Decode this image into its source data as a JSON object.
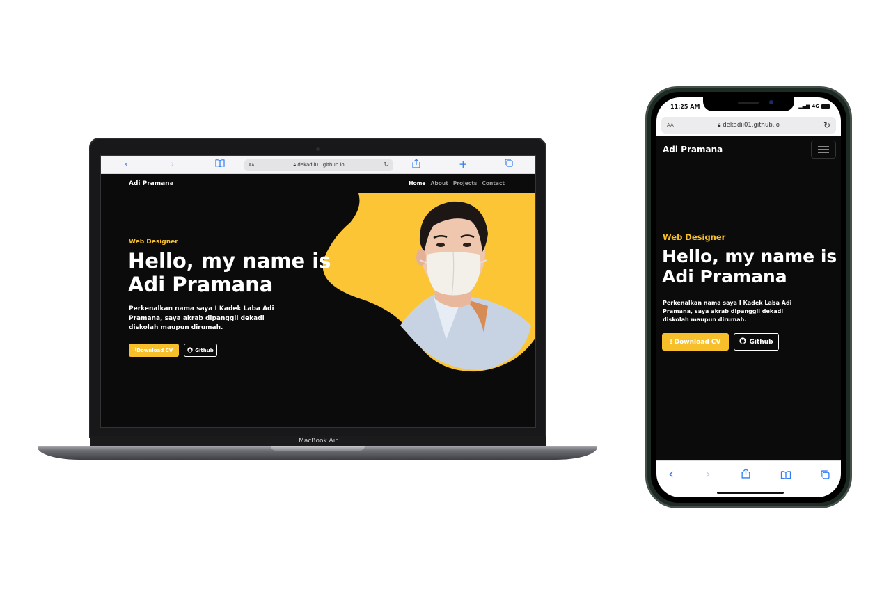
{
  "laptop": {
    "model_label": "MacBook Air",
    "browser": {
      "aa_label": "AA",
      "url": "dekadii01.github.io",
      "icons": [
        "back-icon",
        "forward-icon",
        "bookmarks-icon",
        "reload-icon",
        "share-icon",
        "new-tab-icon",
        "tabs-icon"
      ]
    }
  },
  "phone": {
    "status": {
      "time": "11:25 AM",
      "network": "4G"
    },
    "browser": {
      "aa_label": "AA",
      "url": "dekadii01.github.io",
      "icons": [
        "back-icon",
        "forward-icon",
        "share-icon",
        "bookmarks-icon",
        "tabs-icon"
      ]
    }
  },
  "site": {
    "brand": "Adi Pramana",
    "nav": [
      "Home",
      "About",
      "Projects",
      "Contact"
    ],
    "active_nav": "Home",
    "tagline": "Web Designer",
    "headline_line1": "Hello, my name is",
    "headline_line2": "Adi Pramana",
    "description_line1": "Perkenalkan nama saya I Kadek Laba Adi",
    "description_line2": "Pramana, saya akrab dipanggil dekadi",
    "description_line3": "diskolah maupun dirumah.",
    "download_button": "Download CV",
    "github_button": "Github",
    "colors": {
      "accent": "#f7c02b",
      "background": "#0b0b0b",
      "text": "#ffffff"
    }
  }
}
